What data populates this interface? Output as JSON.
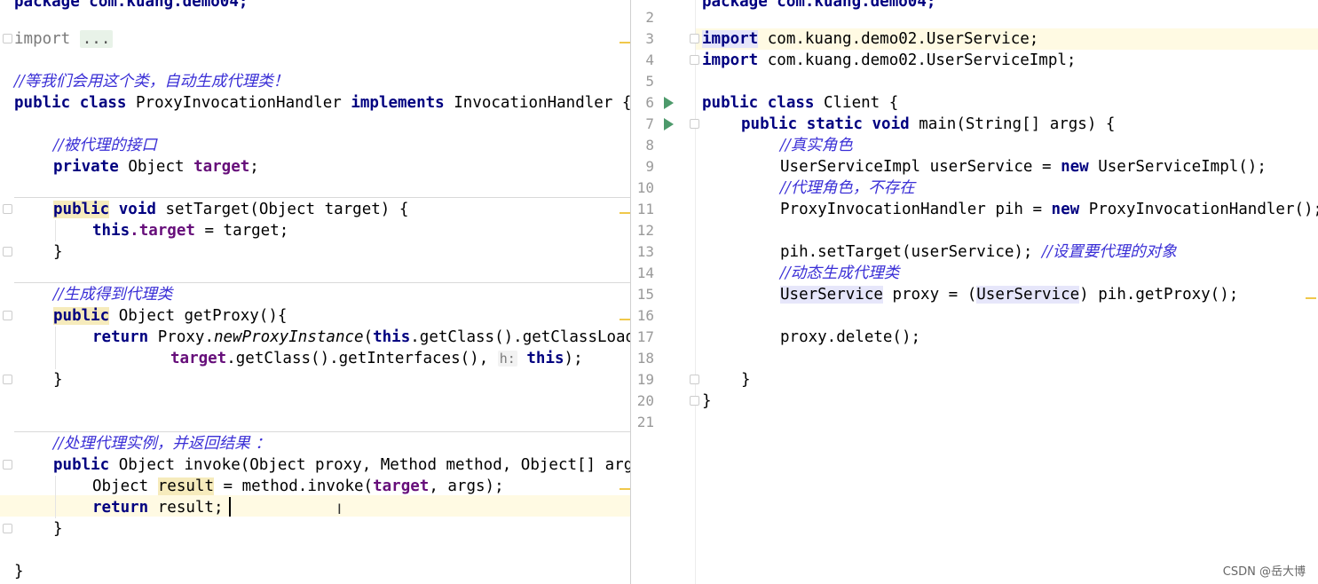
{
  "left_editor": {
    "l0": "package com.kuang.demo04;",
    "import_kw": "import",
    "import_folded": "...",
    "c_class": "//等我们会用这个类，自动生成代理类！",
    "decl": {
      "kw1": "public",
      "kw2": "class",
      "name": "ProxyInvocationHandler",
      "kw3": "implements",
      "iface": "InvocationHandler {"
    },
    "c_target": "//被代理的接口",
    "field": {
      "kw": "private",
      "type": "Object",
      "name": "target",
      "end": ";"
    },
    "settarget": {
      "kw1": "public",
      "kw2": "void",
      "sig": "setTarget(Object target) {"
    },
    "assign": {
      "kw": "this",
      "field": ".target",
      "rest": " = target;"
    },
    "close1": "}",
    "c_getproxy": "//生成得到代理类",
    "getproxy": {
      "kw": "public",
      "sig": "Object getProxy(){"
    },
    "ret1": {
      "kw": "return",
      "cls": "Proxy.",
      "method": "newProxyInstance",
      "arg_kw": "this",
      "rest": ".getClass().getClassLoader(),"
    },
    "ret2": {
      "field": "target",
      "rest": ".getClass().getInterfaces(), ",
      "hint": "h:",
      "kw": "this",
      "end": ");"
    },
    "close2": "}",
    "c_invoke": "//处理代理实例，并返回结果 ：",
    "invoke": {
      "kw": "public",
      "sig": "Object invoke(Object proxy, Method method, Object[] args) throws Throwable {"
    },
    "result": {
      "pre": "Object ",
      "var": "result",
      "mid": " = method.invoke(",
      "field": "target",
      "end": ", args);"
    },
    "ret3": {
      "kw": "return",
      "rest": " result;"
    },
    "close3": "}",
    "close4": "}"
  },
  "right_editor": {
    "line_numbers": [
      "2",
      "3",
      "4",
      "5",
      "6",
      "7",
      "8",
      "9",
      "10",
      "11",
      "12",
      "13",
      "14",
      "15",
      "16",
      "17",
      "18",
      "19",
      "20",
      "21"
    ],
    "r1": "package com.kuang.demo04;",
    "r3": {
      "kw": "import",
      "rest": " com.kuang.demo02.UserService;"
    },
    "r4": {
      "kw": "import",
      "rest": " com.kuang.demo02.UserServiceImpl;"
    },
    "r6": {
      "kw": "public class",
      "rest": " Client {"
    },
    "r7": {
      "kw": "public static void",
      "rest": " main(String[] args) {"
    },
    "r8": "//真实角色",
    "r9": {
      "pre": "UserServiceImpl userService = ",
      "kw": "new",
      "rest": " UserServiceImpl();"
    },
    "r10": "//代理角色，不存在",
    "r11": {
      "pre": "ProxyInvocationHandler pih = ",
      "kw": "new",
      "rest": " ProxyInvocationHandler();"
    },
    "r13": {
      "code": "pih.setTarget(userService); ",
      "comment": "//设置要代理的对象"
    },
    "r14": "//动态生成代理类",
    "r15": {
      "t1": "UserService",
      "mid1": " proxy = (",
      "t2": "UserService",
      "end": ") pih.getProxy();"
    },
    "r17": "proxy.delete();",
    "r19": "}",
    "r20": "}"
  },
  "watermark": "CSDN @岳大博"
}
